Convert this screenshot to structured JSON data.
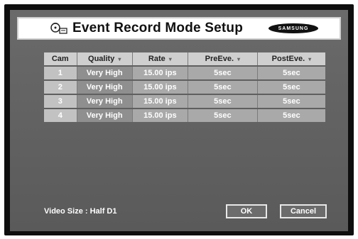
{
  "title": "Event Record Mode Setup",
  "logo_text": "SAMSUNG",
  "table": {
    "headers": [
      "Cam",
      "Quality",
      "Rate",
      "PreEve.",
      "PostEve."
    ],
    "rows": [
      [
        "1",
        "Very High",
        "15.00 ips",
        "5sec",
        "5sec"
      ],
      [
        "2",
        "Very High",
        "15.00 ips",
        "5sec",
        "5sec"
      ],
      [
        "3",
        "Very High",
        "15.00 ips",
        "5sec",
        "5sec"
      ],
      [
        "4",
        "Very High",
        "15.00 ips",
        "5sec",
        "5sec"
      ]
    ],
    "sortable_indicator": "▾"
  },
  "footer": {
    "video_size_label": "Video Size : Half D1",
    "ok_label": "OK",
    "cancel_label": "Cancel"
  },
  "icons": {
    "title_icon": "record-disc-icon"
  }
}
